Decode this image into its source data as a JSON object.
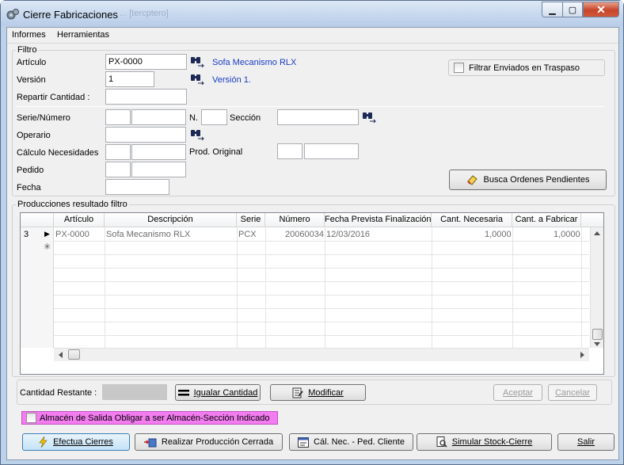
{
  "window": {
    "title": "Cierre Fabricaciones",
    "ghost_title": "...  [tercptero]",
    "min_symbol": "▁",
    "max_symbol": "▢",
    "close_symbol": "✕"
  },
  "menu": {
    "items": [
      "Informes",
      "Herramientas"
    ]
  },
  "filtro": {
    "group_label": "Filtro",
    "articulo_label": "Artículo",
    "articulo_value": "PX-0000",
    "articulo_desc": "Sofa Mecanismo RLX",
    "version_label": "Versión",
    "version_value": "1",
    "version_desc": "Versión 1.",
    "repartir_label": "Repartir Cantidad :",
    "filtrar_enviados_label": "Filtrar Enviados en Traspaso",
    "serie_numero_label": "Serie/Número",
    "n_label": "N.",
    "seccion_label": "Sección",
    "operario_label": "Operario",
    "calculo_label": "Cálculo Necesidades",
    "prod_original_label": "Prod. Original",
    "pedido_label": "Pedido",
    "fecha_label": "Fecha",
    "busca_button": "Busca Ordenes Pendientes"
  },
  "producciones": {
    "group_label": "Producciones resultado filtro",
    "columns": [
      "Artículo",
      "Descripción",
      "Serie",
      "Número",
      "Fecha Prevista Finalización",
      "Cant. Necesaria",
      "Cant. a Fabricar"
    ],
    "row": {
      "index": "3",
      "marker": "▶",
      "new_marker": "✳",
      "articulo": "PX-0000",
      "descripcion": "Sofa Mecanismo RLX",
      "serie": "PCX",
      "numero": "20060034",
      "fecha": "12/03/2016",
      "cant_necesaria": "1,0000",
      "cant_fabricar": "1,0000"
    }
  },
  "cantidad": {
    "restante_label": "Cantidad Restante :",
    "igualar_button": "Igualar Cantidad",
    "modificar_button": "Modificar",
    "aceptar_button": "Aceptar",
    "cancelar_button": "Cancelar"
  },
  "almacen_label": "Almacén de Salida Obligar a ser Almacén-Sección Indicado",
  "bottom": {
    "efectua": "Efectua Cierres",
    "realizar": "Realizar Producción Cerrada",
    "cal_nec": "Cál. Nec. - Ped. Cliente",
    "simular": "Simular Stock-Cierre",
    "salir": "Salir"
  }
}
